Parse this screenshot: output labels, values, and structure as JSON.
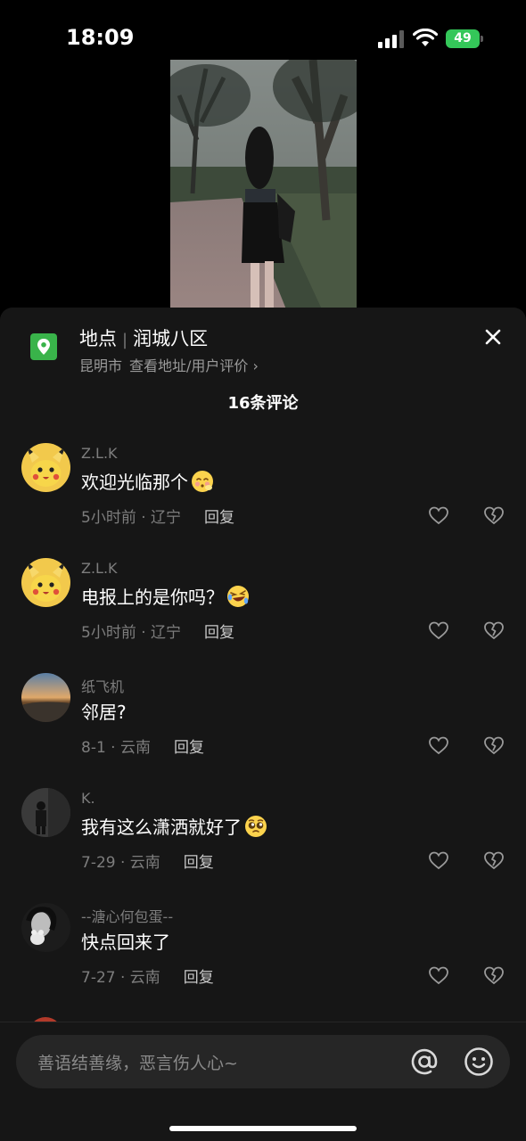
{
  "status_bar": {
    "time": "18:09",
    "battery": "49"
  },
  "location": {
    "label": "地点",
    "name": "润城八区",
    "city": "昆明市",
    "link": "查看地址/用户评价 ›"
  },
  "comments_count": "16条评论",
  "comments": [
    {
      "user": "Z.L.K",
      "text": "欢迎光临那个",
      "emoji": "blushing-face-emoji",
      "time": "5小时前 · 辽宁",
      "reply": "回复"
    },
    {
      "user": "Z.L.K",
      "text": "电报上的是你吗？",
      "emoji": "rofl-face-emoji",
      "time": "5小时前 · 辽宁",
      "reply": "回复"
    },
    {
      "user": "纸飞机",
      "text": "邻居?",
      "time": "8-1 · 云南",
      "reply": "回复"
    },
    {
      "user": "K.",
      "text": "我有这么潇洒就好了",
      "emoji": "pleading-face-emoji",
      "time": "7-29 · 云南",
      "reply": "回复"
    },
    {
      "user": "--溏心何包蛋--",
      "text": "快点回来了",
      "time": "7-27 · 云南",
      "reply": "回复"
    }
  ],
  "input": {
    "placeholder": "善语结善缘，恶言伤人心~"
  },
  "colors": {
    "sheet_bg": "#161616",
    "location_green": "#39b34a",
    "battery_green": "#34c759"
  }
}
